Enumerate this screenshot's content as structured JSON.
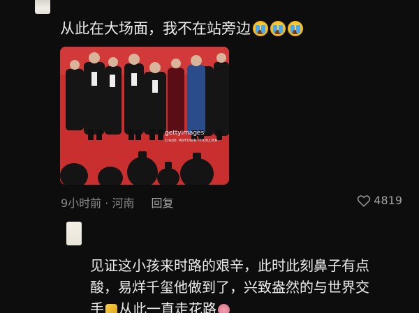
{
  "comment": {
    "text": "从此在大场面，我不在站旁边",
    "emojis": [
      "crying-emoji",
      "crying-emoji",
      "crying-emoji"
    ],
    "photo": {
      "watermark_brand": "gettyimages",
      "watermark_credit": "Credit: ANTONIN THUILLIER"
    },
    "time_location": "9小时前 · 河南",
    "reply_label": "回复",
    "likes": "4819"
  },
  "reply": {
    "line1": "见证这小孩来时路的艰辛，此时此刻鼻子有点",
    "line2": "酸，易烊千玺他做到了，兴致盎然的与世界交",
    "line3_a": "手",
    "line3_b": "从此一直走花路"
  },
  "colors": {
    "background": "#0d0d0d",
    "text": "#ececec",
    "meta": "#8a8a8a",
    "carpet": "#c52b2b"
  }
}
